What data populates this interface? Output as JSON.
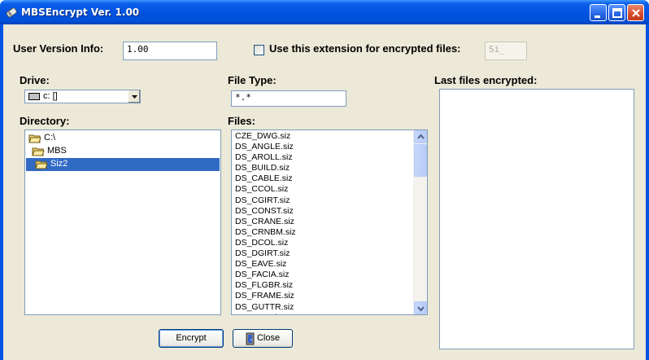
{
  "window": {
    "title": "MBSEncrypt Ver. 1.00"
  },
  "version": {
    "label": "User Version Info:",
    "value": "1.00"
  },
  "extension": {
    "label": "Use this extension for encrypted files:",
    "value": "Si_",
    "checked": false
  },
  "drive": {
    "label": "Drive:",
    "selected": "c: []"
  },
  "file_type": {
    "label": "File Type:",
    "value": "*.*"
  },
  "last_files": {
    "label": "Last files encrypted:"
  },
  "directory": {
    "label": "Directory:",
    "items": [
      {
        "label": "C:\\"
      },
      {
        "label": "MBS"
      },
      {
        "label": "Siz2"
      }
    ]
  },
  "files": {
    "label": "Files:",
    "items": [
      "CZE_DWG.siz",
      "DS_ANGLE.siz",
      "DS_AROLL.siz",
      "DS_BUILD.siz",
      "DS_CABLE.siz",
      "DS_CCOL.siz",
      "DS_CGIRT.siz",
      "DS_CONST.siz",
      "DS_CRANE.siz",
      "DS_CRNBM.siz",
      "DS_DCOL.siz",
      "DS_DGIRT.siz",
      "DS_EAVE.siz",
      "DS_FACIA.siz",
      "DS_FLGBR.siz",
      "DS_FRAME.siz",
      "DS_GUTTR.siz",
      "DS_HHP.siz"
    ]
  },
  "buttons": {
    "encrypt": "Encrypt",
    "close": "Close"
  }
}
